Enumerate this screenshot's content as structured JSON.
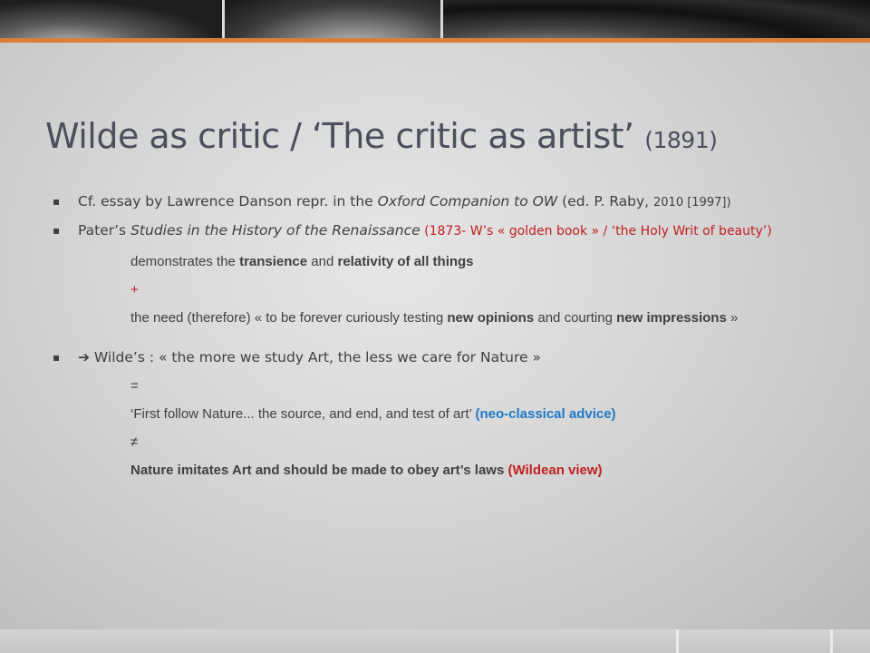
{
  "title": {
    "main": "Wilde as critic /  ‘The critic as artist’",
    "year": "(1891)"
  },
  "bullets": {
    "b1": {
      "a": "Cf. essay by Lawrence Danson repr. in the ",
      "italic": "Oxford Companion to OW",
      "b": " (ed. P. Raby, ",
      "small": "2010 [1997])"
    },
    "b2": {
      "a": "Pater’s ",
      "italic": "Studies in the History of the Renaissance",
      "red": " (1873- W’s « golden book » / ‘the Holy Writ of beauty’)"
    },
    "sub1": {
      "a": "demonstrates the ",
      "b1": "transience",
      "c": " and ",
      "b2": "relativity of all things"
    },
    "plus": "+",
    "sub2": {
      "a": "the need (therefore) « to be forever curiously testing ",
      "b1": "new opinions",
      "c": " and courting ",
      "b2": "new impressions",
      "d": " »"
    },
    "b3": {
      "arrow": "➔",
      "text": " Wilde’s : « the more we study Art, the less we care for Nature »"
    },
    "equals": "=",
    "sub3": {
      "a": "‘First follow Nature... the source, and end, and test of art’ ",
      "blue": "(neo-classical advice)"
    },
    "neq": "≠",
    "sub4": {
      "bold": "Nature imitates Art and should be made to obey art’s laws ",
      "red": "(Wildean view)"
    }
  },
  "colors": {
    "accent": "#dd7d3c",
    "red": "#c0201e",
    "blue": "#1f78c8",
    "title": "#4b4f5c"
  },
  "icons": {
    "bullet": "square-bullet-icon",
    "arrow": "right-arrow-icon"
  }
}
